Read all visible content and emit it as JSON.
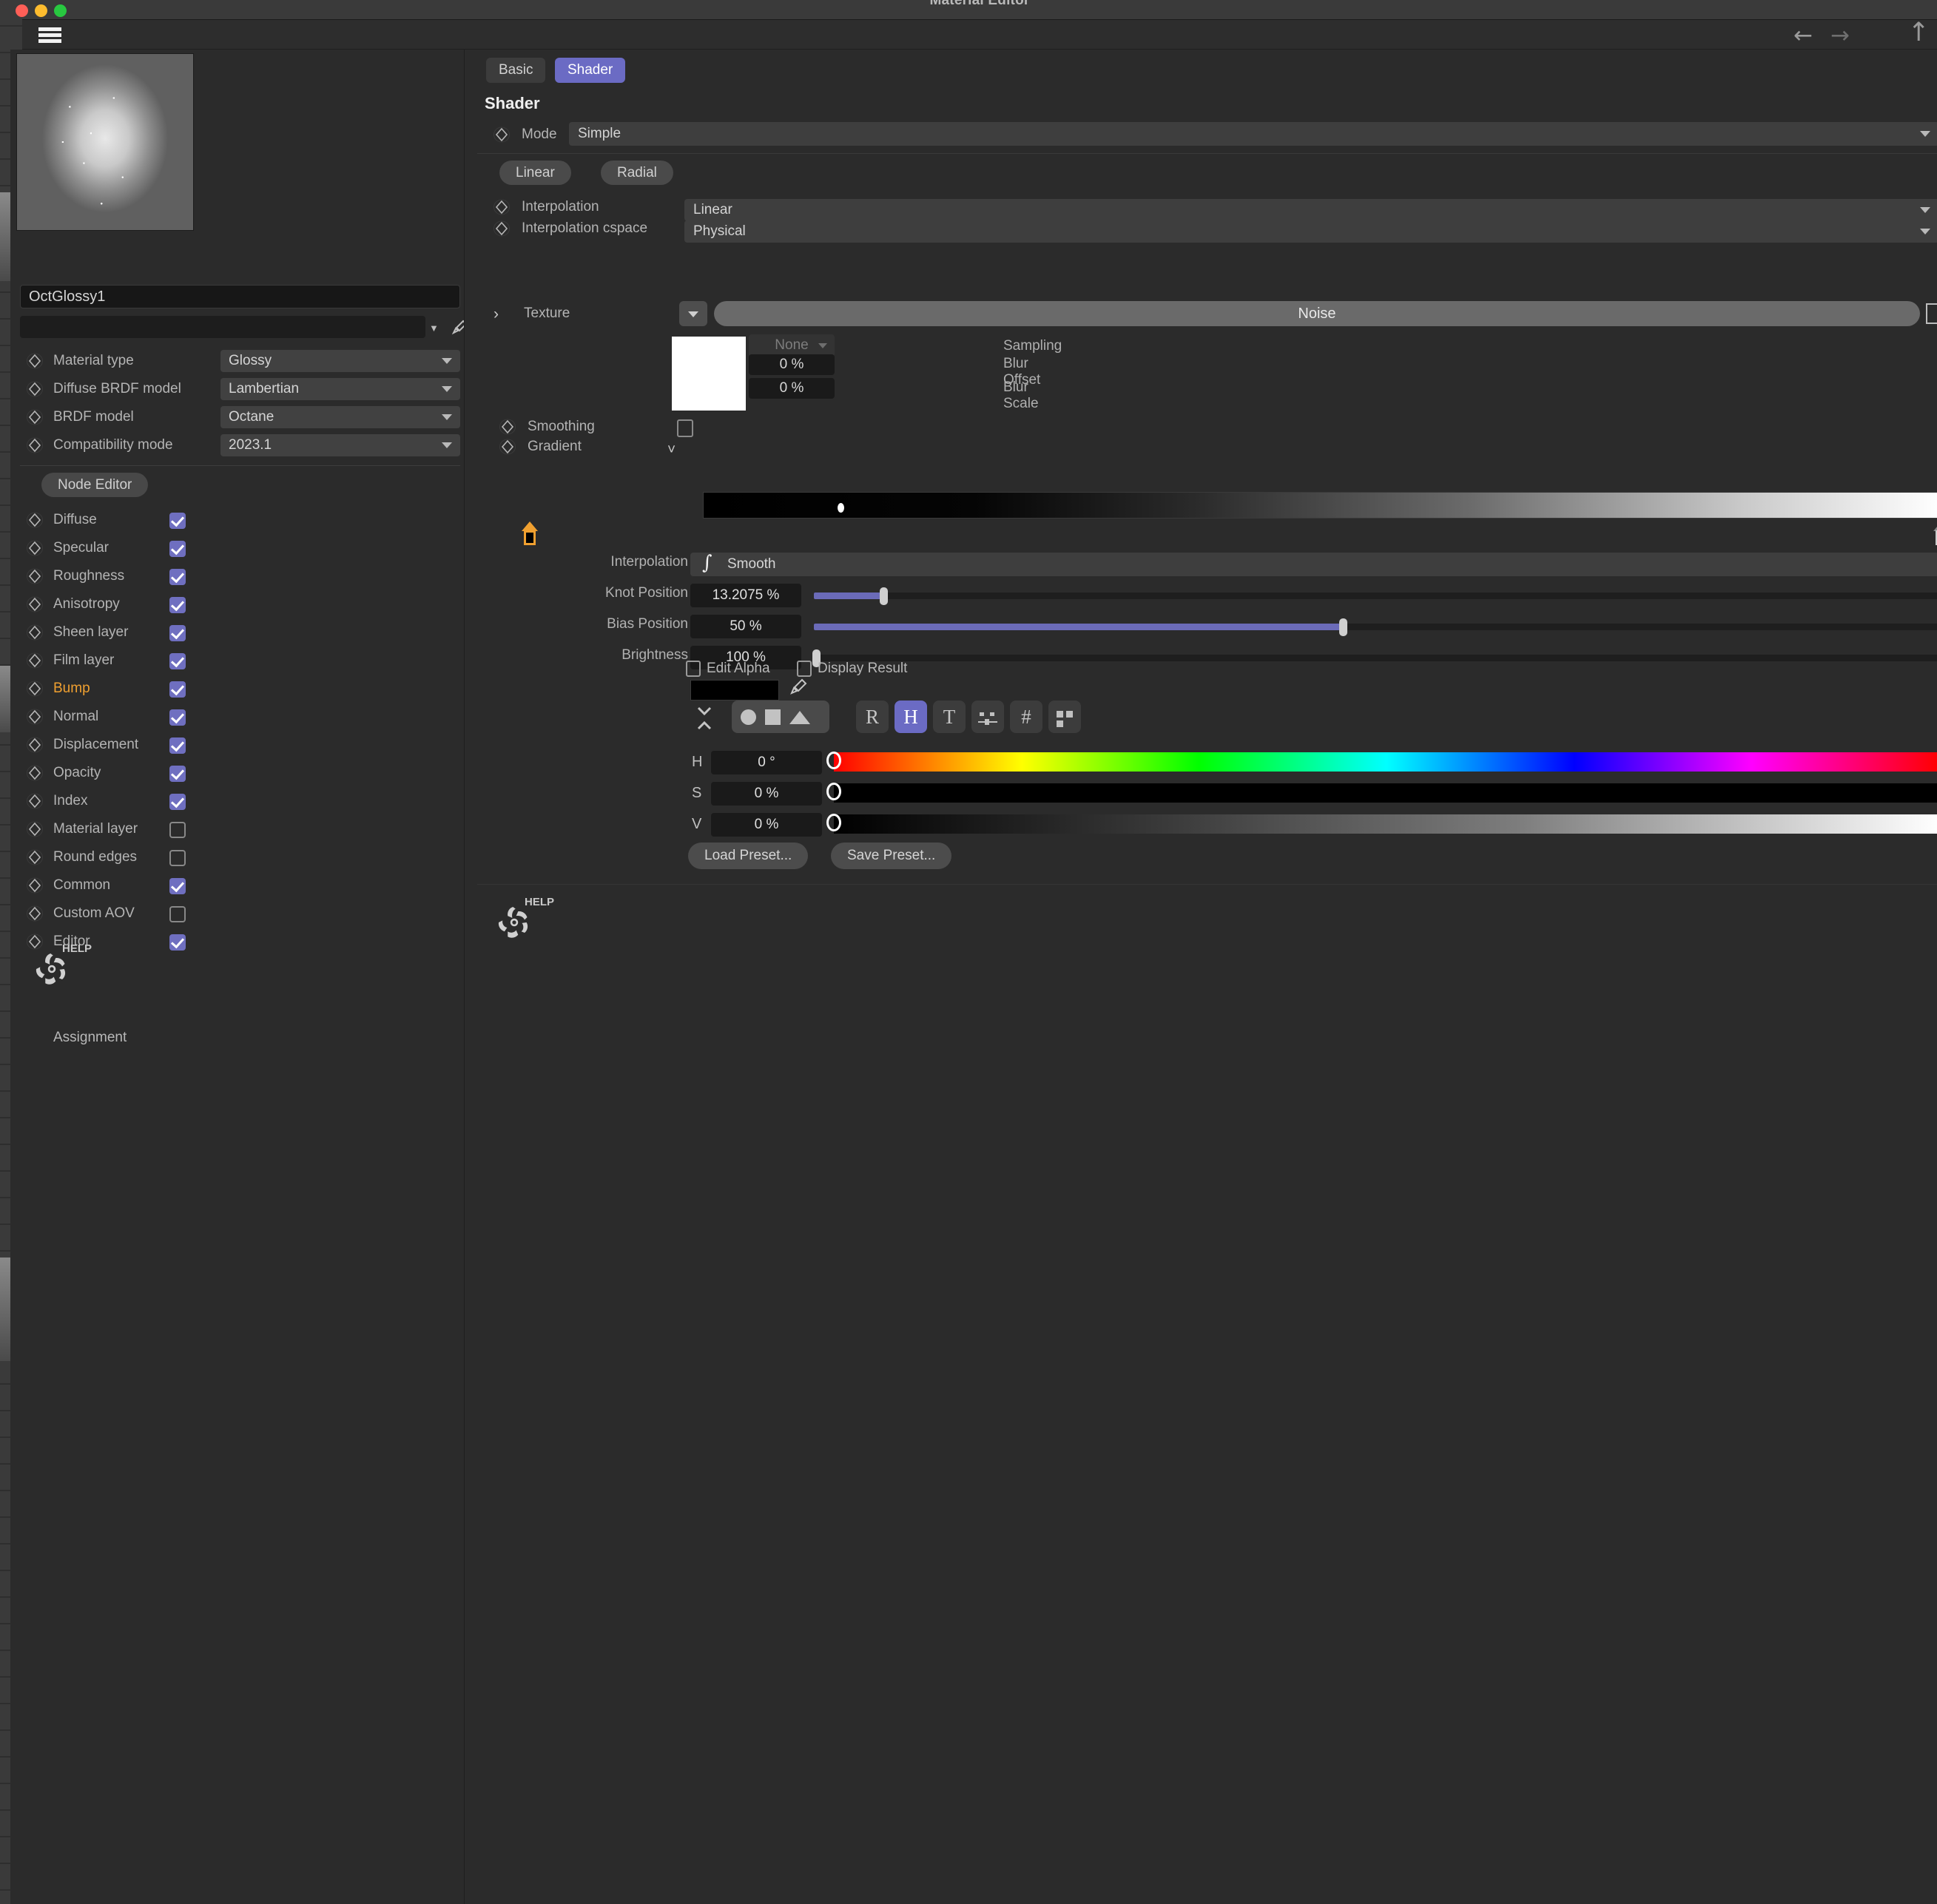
{
  "window": {
    "title": "Material Editor",
    "traffic_lights": [
      "close",
      "minimize",
      "maximize"
    ]
  },
  "toolbar": {
    "menu_icon": "hamburger-icon",
    "back_icon": "arrow-left-icon",
    "forward_icon": "arrow-right-icon",
    "up_icon": "arrow-up-icon"
  },
  "sidebar": {
    "material_name": "OctGlossy1",
    "node_field_value": "",
    "properties": [
      {
        "label": "Material type",
        "value": "Glossy"
      },
      {
        "label": "Diffuse BRDF model",
        "value": "Lambertian"
      },
      {
        "label": "BRDF model",
        "value": "Octane"
      },
      {
        "label": "Compatibility mode",
        "value": "2023.1"
      }
    ],
    "node_editor_label": "Node Editor",
    "channels": [
      {
        "label": "Diffuse",
        "checked": true,
        "highlight": false
      },
      {
        "label": "Specular",
        "checked": true,
        "highlight": false
      },
      {
        "label": "Roughness",
        "checked": true,
        "highlight": false
      },
      {
        "label": "Anisotropy",
        "checked": true,
        "highlight": false
      },
      {
        "label": "Sheen layer",
        "checked": true,
        "highlight": false
      },
      {
        "label": "Film layer",
        "checked": true,
        "highlight": false
      },
      {
        "label": "Bump",
        "checked": true,
        "highlight": true
      },
      {
        "label": "Normal",
        "checked": true,
        "highlight": false
      },
      {
        "label": "Displacement",
        "checked": true,
        "highlight": false
      },
      {
        "label": "Opacity",
        "checked": true,
        "highlight": false
      },
      {
        "label": "Index",
        "checked": true,
        "highlight": false
      },
      {
        "label": "Material layer",
        "checked": false,
        "highlight": false
      },
      {
        "label": "Round edges",
        "checked": false,
        "highlight": false
      },
      {
        "label": "Common",
        "checked": true,
        "highlight": false
      },
      {
        "label": "Custom AOV",
        "checked": false,
        "highlight": false
      },
      {
        "label": "Editor",
        "checked": true,
        "highlight": false
      }
    ],
    "help_label": "HELP",
    "assignment_label": "Assignment"
  },
  "main": {
    "tabs": [
      {
        "label": "Basic",
        "active": false
      },
      {
        "label": "Shader",
        "active": true
      }
    ],
    "heading": "Shader",
    "mode": {
      "label": "Mode",
      "value": "Simple"
    },
    "pills": [
      {
        "label": "Linear"
      },
      {
        "label": "Radial"
      }
    ],
    "rows": [
      {
        "label": "Interpolation",
        "value": "Linear"
      },
      {
        "label": "Interpolation cspace",
        "value": "Physical"
      }
    ],
    "texture": {
      "label": "Texture",
      "node_name": "Noise",
      "expand_icon": "chevron-right-icon",
      "dropdown_icon": "chevron-down-icon",
      "swatch_color": "#ffffff",
      "sampling_label": "Sampling",
      "sampling_value": "None",
      "blur_offset_label": "Blur Offset",
      "blur_offset_value": "0 %",
      "blur_scale_label": "Blur Scale",
      "blur_scale_value": "0 %"
    },
    "smoothing": {
      "label": "Smoothing",
      "checked": false
    },
    "gradient": {
      "label": "Gradient",
      "knots": [
        {
          "position_pct": 13.2075,
          "color": "#000000",
          "selected": true
        },
        {
          "position_pct": 100.0,
          "color": "#ffffff",
          "selected": false
        }
      ],
      "interpolation_label": "Interpolation",
      "interpolation_value": "Smooth",
      "knot_position_label": "Knot Position",
      "knot_position_value": "13.2075 %",
      "knot_position_fraction": 0.0615,
      "bias_position_label": "Bias Position",
      "bias_position_value": "50 %",
      "bias_position_fraction": 0.47,
      "brightness_label": "Brightness",
      "brightness_value": "100 %",
      "brightness_fraction": 0.003
    },
    "color_picker": {
      "edit_alpha_label": "Edit Alpha",
      "edit_alpha_checked": false,
      "display_result_label": "Display Result",
      "display_result_checked": false,
      "current_color": "#000000",
      "eyedropper_icon": "eyedropper-icon",
      "expand_icon": "expand-collapse-icon",
      "shape_icons": [
        "circle-icon",
        "square-icon",
        "mountain-icon"
      ],
      "mode_buttons": [
        {
          "label": "R",
          "active": false,
          "name": "rgb-mode-button"
        },
        {
          "label": "H",
          "active": true,
          "name": "hsv-mode-button"
        },
        {
          "label": "T",
          "active": false,
          "name": "temperature-mode-button"
        },
        {
          "label": "",
          "active": false,
          "name": "sliders-icon"
        },
        {
          "label": "#",
          "active": false,
          "name": "hex-mode-button"
        },
        {
          "label": "",
          "active": false,
          "name": "swatches-icon"
        }
      ],
      "channels": [
        {
          "label": "H",
          "value": "0 °",
          "fraction": 0.0
        },
        {
          "label": "S",
          "value": "0 %",
          "fraction": 0.0
        },
        {
          "label": "V",
          "value": "0 %",
          "fraction": 0.0
        }
      ]
    },
    "presets": {
      "load_label": "Load Preset...",
      "save_label": "Save Preset..."
    },
    "help_label": "HELP"
  },
  "colors": {
    "accent": "#6b6bc4",
    "highlight_text": "#f0a030",
    "panel_bg": "#2b2b2b",
    "field_bg": "#1a1a1a",
    "select_bg": "#3e3e3e"
  }
}
